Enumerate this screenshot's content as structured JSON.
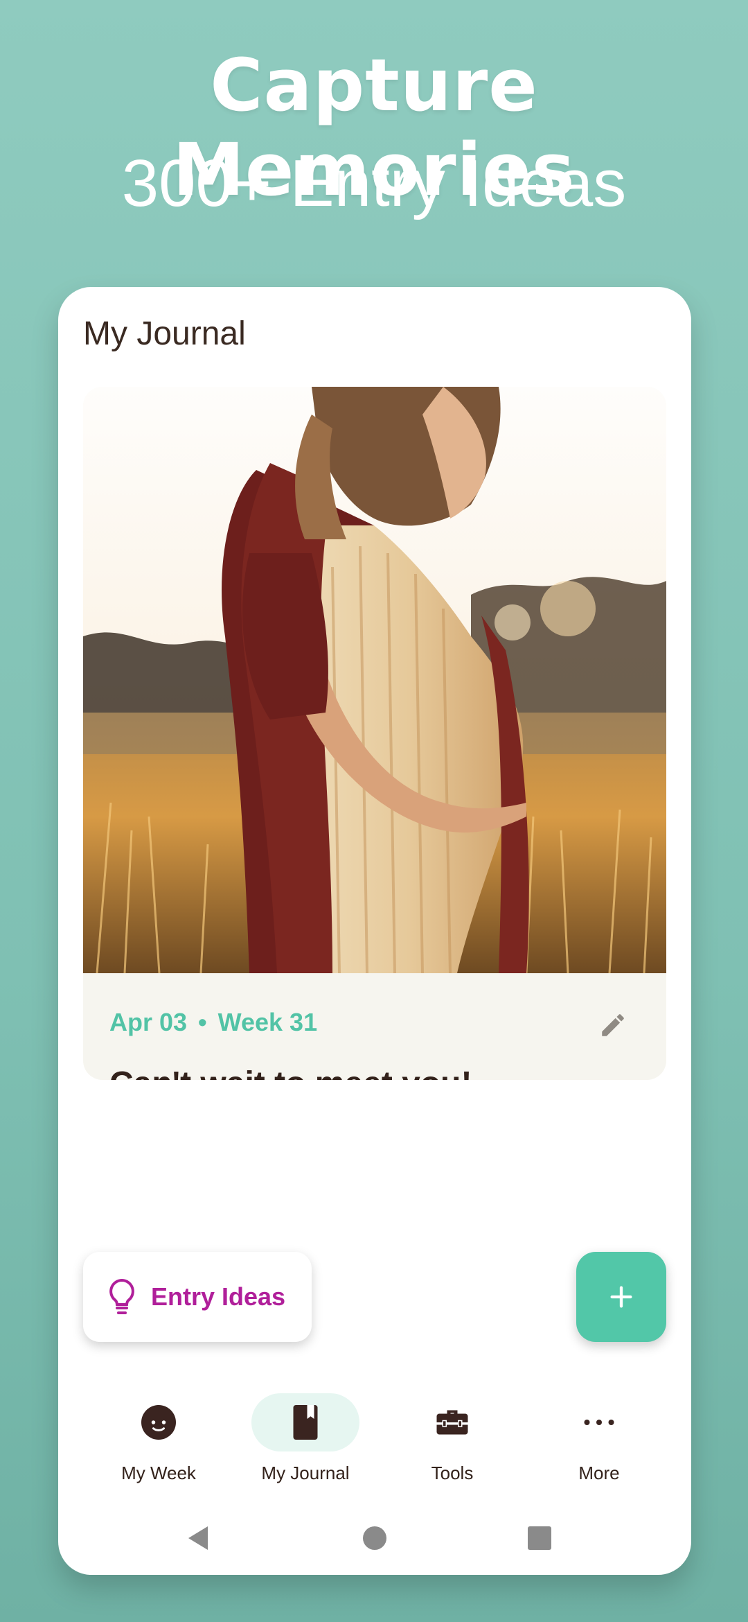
{
  "promo": {
    "headline": "Capture Memories",
    "subheadline": "300+ Entry Ideas"
  },
  "app": {
    "title": "My Journal"
  },
  "entry": {
    "date": "Apr 03",
    "separator": "•",
    "week": "Week 31",
    "text": "Can't wait to meet you!"
  },
  "actions": {
    "ideas_label": "Entry Ideas",
    "add_label": "+"
  },
  "nav": {
    "items": [
      {
        "label": "My Week",
        "icon": "baby-face-icon"
      },
      {
        "label": "My Journal",
        "icon": "journal-icon",
        "active": true
      },
      {
        "label": "Tools",
        "icon": "toolbox-icon"
      },
      {
        "label": "More",
        "icon": "more-dots-icon"
      }
    ]
  },
  "colors": {
    "accent": "#52c7a8",
    "ideas": "#b01f9a",
    "text_dark": "#33221b",
    "background": "#8fcbbf"
  }
}
